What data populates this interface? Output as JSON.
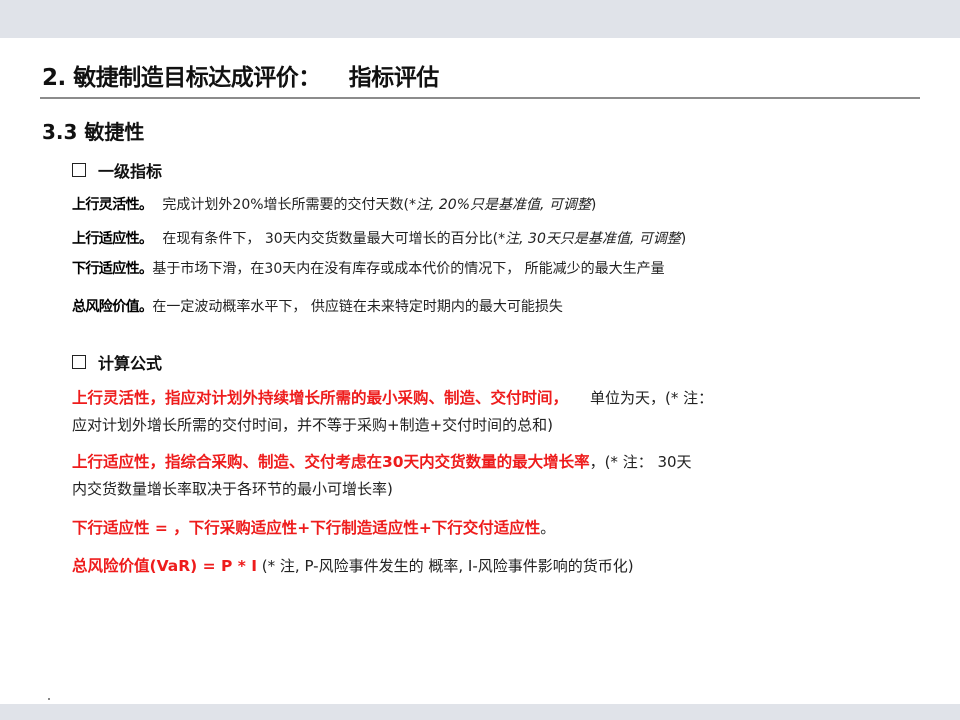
{
  "header": {
    "title_main": "2. 敏捷制造目标达成评价：",
    "title_sub": "指标评估"
  },
  "section": {
    "heading": "3.3 敏捷性"
  },
  "level1": {
    "heading": "一级指标",
    "items": [
      {
        "label": "上行灵活性。",
        "text": "完成计划外20%增长所需要的交付天数(",
        "note": "*注,  20%只是基准值,   可调整",
        "close": ")"
      },
      {
        "label": "上行适应性。",
        "text": "在现有条件下，  30天内交货数量最大可增长的百分比(",
        "note": "*注,  30天只是基准值,   可调整",
        "close": ")"
      },
      {
        "label": "下行适应性。",
        "text": "基于市场下滑，在30天内在没有库存或成本代价的情况下，  所能减少的最大生产量"
      },
      {
        "label": "总风险价值。",
        "text": "在一定波动概率水平下，  供应链在未来特定时期内的最大可能损失"
      }
    ]
  },
  "formulas": {
    "heading": "计算公式",
    "f1": {
      "red": "上行灵活性，指应对计划外持续增长所需的最小采购、制造、交付时间，",
      "text": "单位为天，(* 注：",
      "text2": "应对计划外增长所需的交付时间，并不等于采购+制造+交付时间的总和)"
    },
    "f2": {
      "red": "上行适应性，指综合采购、制造、交付考虑在30天内交货数量的最大增长率",
      "text": "，(* 注：   30天",
      "text2": "内交货数量增长率取决于各环节的最小可增长率)"
    },
    "f3": {
      "red": "下行适应性 = ，下行采购适应性+下行制造适应性+下行交付适应性",
      "text": "。"
    },
    "f4": {
      "red": "总风险价值(VaR) = P * I",
      "text": " (* 注,   P-风险事件发生的 概率,   I-风险事件影响的货币化)"
    }
  },
  "colors": {
    "accent_red": "#ee1c1c",
    "band": "#e0e3e9",
    "rule": "#8c8c8c"
  }
}
